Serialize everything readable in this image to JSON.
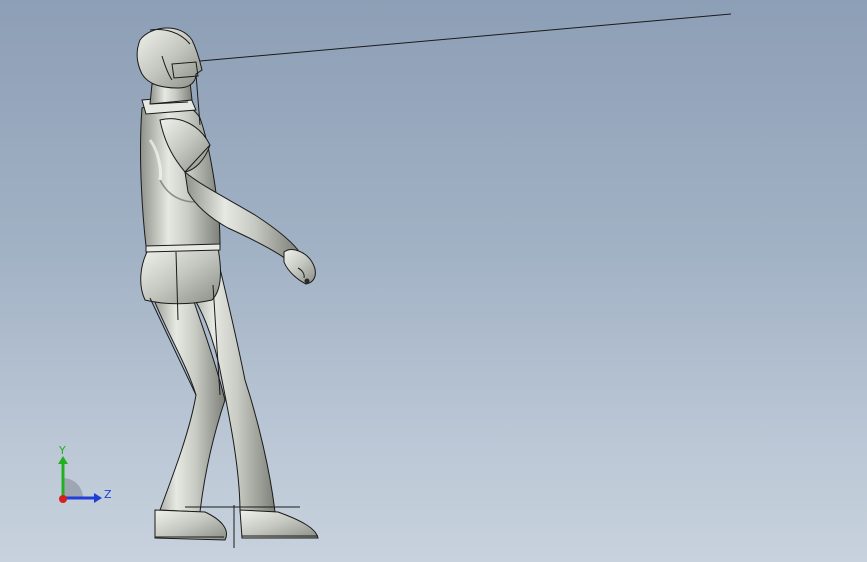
{
  "viewport": {
    "background_top": "#8d9fb6",
    "background_bottom": "#c8d2de"
  },
  "model": {
    "body_color": "#cfd2cb",
    "edge_color": "#1a1a1a"
  },
  "triad": {
    "y_label": "Y",
    "z_label": "Z",
    "y_color": "#22b022",
    "z_color": "#1f3fd6",
    "x_color": "#d61f1f"
  }
}
